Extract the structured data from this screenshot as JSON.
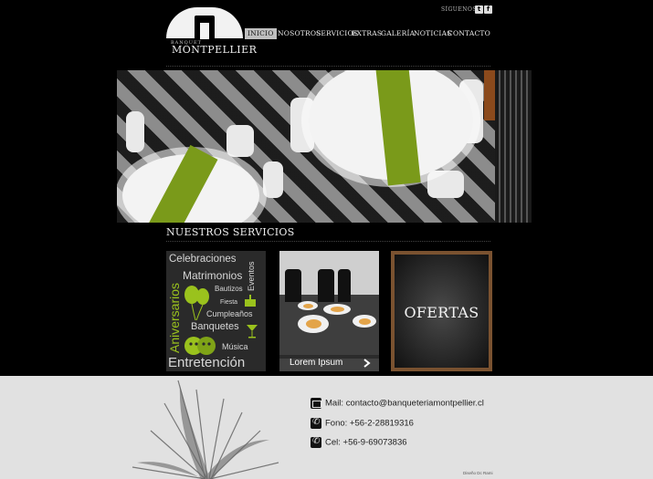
{
  "header": {
    "logo_small": "BANQUET",
    "logo_text": "MONTPELLIER",
    "follow_label": "SÍGUENOS",
    "social": [
      "twitter-icon",
      "facebook-icon"
    ]
  },
  "nav": {
    "items": [
      "INICIO",
      "NOSOTROS",
      "SERVICIOS",
      "EXTRAS",
      "GALERÍA",
      "NOTICIAS",
      "CONTACTO"
    ],
    "active": "INICIO"
  },
  "section": {
    "title": "NUESTROS SERVICIOS"
  },
  "card1": {
    "words": [
      "Celebraciones",
      "Matrimonios",
      "Eventos",
      "Bautizos",
      "Fiesta",
      "Aniversarios",
      "Cumpleaños",
      "Banquetes",
      "Música",
      "Entretención"
    ]
  },
  "card2": {
    "caption": "Lorem Ipsum"
  },
  "card3": {
    "label": "OFERTAS"
  },
  "footer": {
    "mail": "Mail: contacto@banqueteriamontpellier.cl",
    "fono": "Fono: +56-2-28819316",
    "cel": "Cel: +56-9-69073836",
    "credit": "Diseño Dc Rami"
  },
  "colors": {
    "accent_green": "#9ac21d",
    "footer_bg": "#e1e1e1",
    "frame_wood": "#7a5230"
  }
}
